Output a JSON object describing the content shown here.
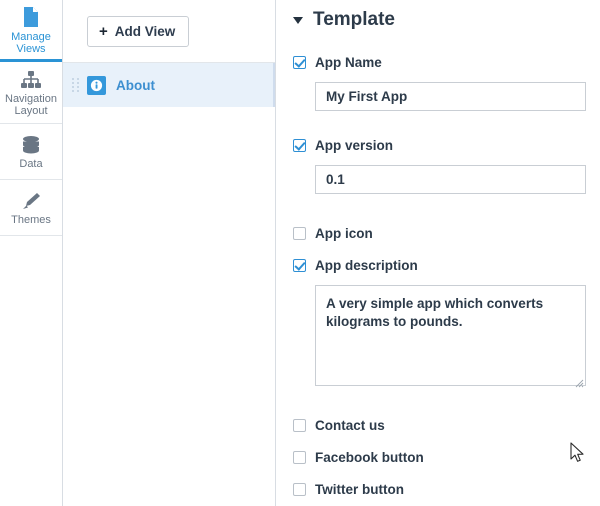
{
  "rail": {
    "items": [
      {
        "label": "Manage\nViews",
        "icon": "document-icon",
        "active": true
      },
      {
        "label": "Navigation\nLayout",
        "icon": "sitemap-icon",
        "active": false
      },
      {
        "label": "Data",
        "icon": "database-icon",
        "active": false
      },
      {
        "label": "Themes",
        "icon": "paintbrush-icon",
        "active": false
      }
    ],
    "accent_color": "#2a93d5"
  },
  "viewlist": {
    "add_view_label": "Add View",
    "add_view_plus": "+",
    "rows": [
      {
        "label": "About",
        "icon": "info-icon",
        "selected": true
      }
    ]
  },
  "properties": {
    "section_title": "Template",
    "fields": [
      {
        "label": "App Name",
        "checked": true,
        "value": "My First App"
      },
      {
        "label": "App version",
        "checked": true,
        "value": "0.1"
      },
      {
        "label": "App icon",
        "checked": false
      },
      {
        "label": "App description",
        "checked": true,
        "value": "A very simple app which converts kilograms to pounds."
      },
      {
        "label": "Contact us",
        "checked": false
      },
      {
        "label": "Facebook button",
        "checked": false
      },
      {
        "label": "Twitter button",
        "checked": false
      }
    ]
  },
  "colors": {
    "accent": "#2a93d5",
    "checkbox_on": "#2e8fd4",
    "selected_row_bg": "#e8f1fa",
    "text": "#2d3b4a"
  }
}
